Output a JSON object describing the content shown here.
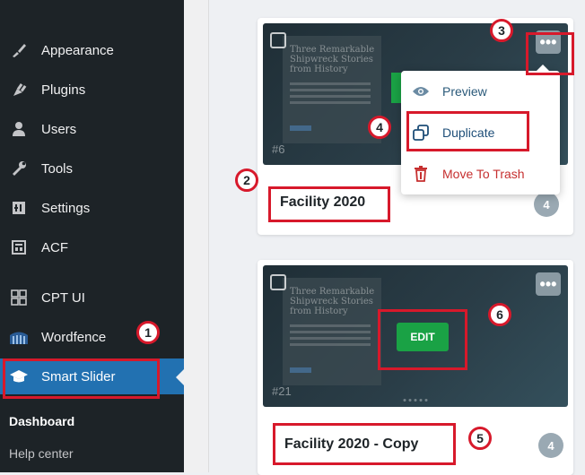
{
  "sidebar": {
    "items": [
      {
        "label": "Appearance",
        "icon": "paintbrush-icon"
      },
      {
        "label": "Plugins",
        "icon": "plug-icon"
      },
      {
        "label": "Users",
        "icon": "user-icon"
      },
      {
        "label": "Tools",
        "icon": "wrench-icon"
      },
      {
        "label": "Settings",
        "icon": "settings-icon"
      },
      {
        "label": "ACF",
        "icon": "acf-icon"
      },
      {
        "label": "CPT UI",
        "icon": "grid-icon"
      },
      {
        "label": "Wordfence",
        "icon": "wordfence-icon"
      },
      {
        "label": "Smart Slider",
        "icon": "graduation-cap-icon"
      }
    ],
    "submenu": [
      {
        "label": "Dashboard"
      },
      {
        "label": "Help center"
      }
    ]
  },
  "cards": [
    {
      "title": "Facility 2020",
      "slide_id": "#6",
      "count": "4",
      "thumb_text": "Three Remarkable Shipwreck Stories from History"
    },
    {
      "title": "Facility 2020 - Copy",
      "slide_id": "#21",
      "count": "4",
      "edit_label": "EDIT",
      "thumb_text": "Three Remarkable Shipwreck Stories from History"
    }
  ],
  "dropdown": {
    "items": [
      {
        "label": "Preview",
        "icon": "eye-icon"
      },
      {
        "label": "Duplicate",
        "icon": "duplicate-icon"
      },
      {
        "label": "Move To Trash",
        "icon": "trash-icon"
      }
    ]
  },
  "annotations": {
    "markers": [
      "1",
      "2",
      "3",
      "4",
      "5",
      "6"
    ],
    "color": "#d7192b"
  },
  "colors": {
    "sidebar_bg": "#1d2327",
    "active_bg": "#2271b1",
    "edit_green": "#1aa245",
    "trash_red": "#c62f2f"
  }
}
